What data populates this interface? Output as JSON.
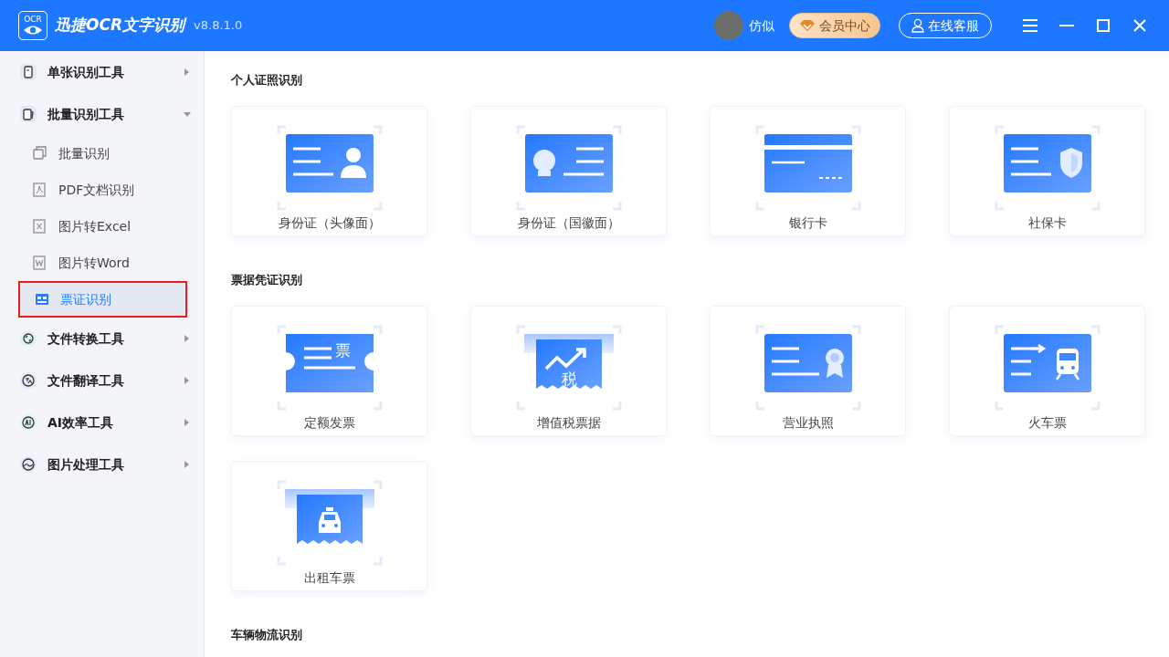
{
  "window": {
    "logo_text": "OCR",
    "app_name": "迅捷OCR文字识别",
    "version": "v8.8.1.0"
  },
  "header": {
    "user_name": "仿似",
    "vip_button": "会员中心",
    "service_button": "在线客服"
  },
  "sidebar": {
    "groups": [
      {
        "label": "单张识别工具",
        "expanded": false
      },
      {
        "label": "批量识别工具",
        "expanded": true,
        "children": [
          {
            "label": "批量识别",
            "selected": false
          },
          {
            "label": "PDF文档识别",
            "selected": false
          },
          {
            "label": "图片转Excel",
            "selected": false
          },
          {
            "label": "图片转Word",
            "selected": false
          },
          {
            "label": "票证识别",
            "selected": true
          }
        ]
      },
      {
        "label": "文件转换工具",
        "expanded": false
      },
      {
        "label": "文件翻译工具",
        "expanded": false
      },
      {
        "label": "AI效率工具",
        "expanded": false
      },
      {
        "label": "图片处理工具",
        "expanded": false
      }
    ]
  },
  "sections": [
    {
      "title": "个人证照识别",
      "cards": [
        {
          "label": "身份证（头像面）"
        },
        {
          "label": "身份证（国徽面）"
        },
        {
          "label": "银行卡"
        },
        {
          "label": "社保卡"
        }
      ]
    },
    {
      "title": "票据凭证识别",
      "cards": [
        {
          "label": "定额发票",
          "icon_text": "票"
        },
        {
          "label": "增值税票据",
          "icon_text": "税"
        },
        {
          "label": "营业执照"
        },
        {
          "label": "火车票"
        },
        {
          "label": "出租车票"
        }
      ]
    },
    {
      "title": "车辆物流识别"
    }
  ]
}
